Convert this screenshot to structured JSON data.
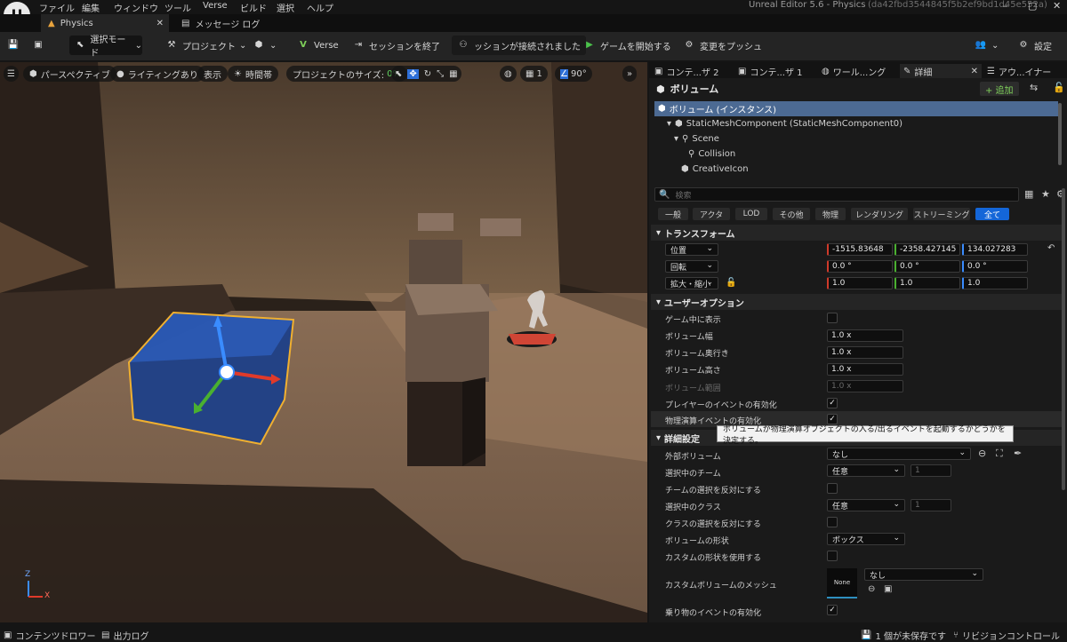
{
  "menubar": {
    "items": [
      "ファイル",
      "編集",
      "ウィンドウ",
      "ツール",
      "Verse",
      "ビルド",
      "選択",
      "ヘルプ"
    ],
    "window_title": "Unreal Editor 5.6 - Physics",
    "session_id": "(da42fbd3544845f5b2ef9bd1d45e552a)"
  },
  "tabs": {
    "active": "Physics",
    "message_log": "メッセージ ログ"
  },
  "toolbar": {
    "select_mode": "選択モード",
    "project": "プロジェクト",
    "verse": "Verse",
    "end_session": "セッションを終了",
    "session_connected": "ッションが接続されました",
    "start_game": "ゲームを開始する",
    "push_changes": "変更をプッシュ",
    "settings": "設定"
  },
  "viewport": {
    "perspective": "パースペクティブ",
    "lighting": "ライティングあり",
    "show": "表示",
    "time_of_day": "時間帯",
    "project_size_label": "プロジェクトのサイズ:",
    "project_size_value": "0%",
    "grid_count": "1",
    "angle": "90°",
    "axis_z": "Z",
    "axis_x": "X"
  },
  "panel_tabs": {
    "content2": "コンテ...ザ 2",
    "content1": "コンテ...ザ 1",
    "world": "ワール...ング",
    "details": "詳細",
    "outliner": "アウ...イナー"
  },
  "details": {
    "title": "ボリューム",
    "add": "+ 追加",
    "tree": [
      "ボリューム (インスタンス)",
      "StaticMeshComponent (StaticMeshComponent0)",
      "Scene",
      "Collision",
      "CreativeIcon"
    ],
    "search_placeholder": "検索",
    "filters": [
      "一般",
      "アクタ",
      "LOD",
      "その他",
      "物理",
      "レンダリング",
      "ストリーミング",
      "全て"
    ],
    "transform_header": "トランスフォーム",
    "location_label": "位置",
    "rotation_label": "回転",
    "scale_label": "拡大・縮小",
    "location": [
      "-1515.83648",
      "-2358.427145",
      "134.027283"
    ],
    "rotation": [
      "0.0 °",
      "0.0 °",
      "0.0 °"
    ],
    "scale": [
      "1.0",
      "1.0",
      "1.0"
    ],
    "user_options_header": "ユーザーオプション",
    "props": {
      "visible_in_game": "ゲーム中に表示",
      "vol_width": "ボリューム幅",
      "vol_width_val": "1.0 x",
      "vol_depth": "ボリューム奥行き",
      "vol_depth_val": "1.0 x",
      "vol_height": "ボリューム高さ",
      "vol_height_val": "1.0 x",
      "vol_range": "ボリューム範囲",
      "vol_range_val": "1.0 x",
      "enable_player_events": "プレイヤーのイベントの有効化",
      "enable_physics_events": "物理演算イベントの有効化"
    },
    "tooltip": "ボリュームが物理演算オブジェクトの入る/出るイベントを起動するかどうかを決定する。",
    "detail_settings_header": "詳細設定",
    "adv": {
      "external_volume": "外部ボリューム",
      "external_volume_val": "なし",
      "selected_team": "選択中のチーム",
      "selected_team_val": "任意",
      "team_num": "1",
      "invert_team": "チームの選択を反対にする",
      "selected_class": "選択中のクラス",
      "selected_class_val": "任意",
      "class_num": "1",
      "invert_class": "クラスの選択を反対にする",
      "volume_shape": "ボリュームの形状",
      "volume_shape_val": "ボックス",
      "use_custom_shape": "カスタムの形状を使用する",
      "custom_mesh": "カスタムボリュームのメッシュ",
      "custom_mesh_val": "なし",
      "thumb": "None",
      "vehicle_events": "乗り物のイベントの有効化"
    }
  },
  "statusbar": {
    "content_drawer": "コンテンツドロワー",
    "output_log": "出力ログ",
    "unsaved": "1 個が未保存です",
    "revision_control": "リビジョンコントロール"
  }
}
